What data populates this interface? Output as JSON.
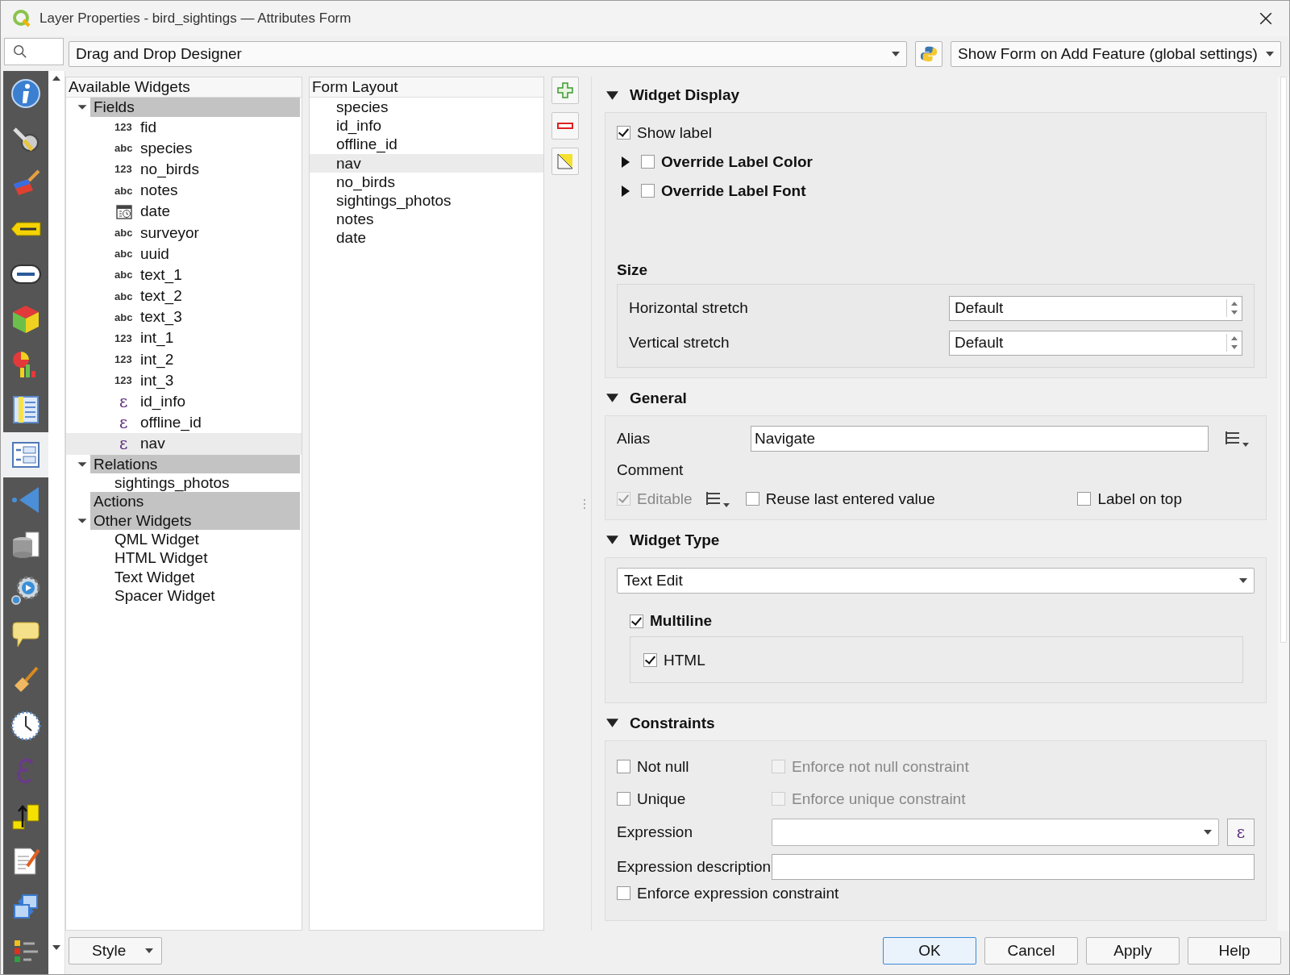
{
  "window": {
    "title": "Layer Properties - bird_sightings — Attributes Form"
  },
  "designer_mode": "Drag and Drop Designer",
  "form_mode": "Show Form on Add Feature (global settings)",
  "sidebar": [
    {
      "kind": "info",
      "selected": false
    },
    {
      "kind": "tools",
      "selected": false
    },
    {
      "kind": "paintbrush",
      "selected": false
    },
    {
      "kind": "label-tag",
      "selected": false
    },
    {
      "kind": "label-bubble",
      "selected": false
    },
    {
      "kind": "cube",
      "selected": false
    },
    {
      "kind": "diagram",
      "selected": false
    },
    {
      "kind": "table",
      "selected": false
    },
    {
      "kind": "form",
      "selected": true
    },
    {
      "kind": "triangle",
      "selected": false
    },
    {
      "kind": "database",
      "selected": false
    },
    {
      "kind": "gear",
      "selected": false
    },
    {
      "kind": "speech",
      "selected": false
    },
    {
      "kind": "brush",
      "selected": false
    },
    {
      "kind": "clock",
      "selected": false
    },
    {
      "kind": "epsilon",
      "selected": false
    },
    {
      "kind": "elevation",
      "selected": false
    },
    {
      "kind": "document",
      "selected": false
    },
    {
      "kind": "sync",
      "selected": false
    },
    {
      "kind": "legend",
      "selected": false
    }
  ],
  "available_widgets": {
    "title": "Available Widgets",
    "groups": [
      {
        "label": "Fields",
        "expanded": true,
        "items": [
          {
            "kind": "badge",
            "badge": "123",
            "label": "fid",
            "selected": false
          },
          {
            "kind": "badge",
            "badge": "abc",
            "label": "species",
            "selected": false
          },
          {
            "kind": "badge",
            "badge": "123",
            "label": "no_birds",
            "selected": false
          },
          {
            "kind": "badge",
            "badge": "abc",
            "label": "notes",
            "selected": false
          },
          {
            "kind": "calendar",
            "label": "date",
            "selected": false
          },
          {
            "kind": "badge",
            "badge": "abc",
            "label": "surveyor",
            "selected": false
          },
          {
            "kind": "badge",
            "badge": "abc",
            "label": "uuid",
            "selected": false
          },
          {
            "kind": "badge",
            "badge": "abc",
            "label": "text_1",
            "selected": false
          },
          {
            "kind": "badge",
            "badge": "abc",
            "label": "text_2",
            "selected": false
          },
          {
            "kind": "badge",
            "badge": "abc",
            "label": "text_3",
            "selected": false
          },
          {
            "kind": "badge",
            "badge": "123",
            "label": "int_1",
            "selected": false
          },
          {
            "kind": "badge",
            "badge": "123",
            "label": "int_2",
            "selected": false
          },
          {
            "kind": "badge",
            "badge": "123",
            "label": "int_3",
            "selected": false
          },
          {
            "kind": "expression",
            "badge": "ε",
            "label": "id_info",
            "selected": false
          },
          {
            "kind": "expression",
            "badge": "ε",
            "label": "offline_id",
            "selected": false
          },
          {
            "kind": "expression",
            "badge": "ε",
            "label": "nav",
            "selected": true
          }
        ]
      },
      {
        "label": "Relations",
        "expanded": true,
        "items": [
          {
            "kind": "plain",
            "label": "sightings_photos",
            "selected": false
          }
        ]
      },
      {
        "label": "Actions"
      },
      {
        "label": "Other Widgets",
        "expanded": true,
        "items": [
          {
            "kind": "plain",
            "label": "QML Widget",
            "selected": false
          },
          {
            "kind": "plain",
            "label": "HTML Widget",
            "selected": false
          },
          {
            "kind": "plain",
            "label": "Text Widget",
            "selected": false
          },
          {
            "kind": "plain",
            "label": "Spacer Widget",
            "selected": false
          }
        ]
      }
    ]
  },
  "form_layout": {
    "title": "Form Layout",
    "items": [
      {
        "label": "species",
        "selected": false
      },
      {
        "label": "id_info",
        "selected": false
      },
      {
        "label": "offline_id",
        "selected": false
      },
      {
        "label": "nav",
        "selected": true
      },
      {
        "label": "no_birds",
        "selected": false
      },
      {
        "label": "sightings_photos",
        "selected": false
      },
      {
        "label": "notes",
        "selected": false
      },
      {
        "label": "date",
        "selected": false
      }
    ]
  },
  "layout_tools": [
    {
      "kind": "add"
    },
    {
      "kind": "remove"
    },
    {
      "kind": "edit"
    }
  ],
  "widget_display": {
    "title": "Widget Display",
    "expanded": true,
    "show_label": {
      "label": "Show label",
      "checked": true
    },
    "overrides": [
      {
        "label": "Override Label Color",
        "checked": false,
        "expanded": false
      },
      {
        "label": "Override Label Font",
        "checked": false,
        "expanded": false
      }
    ],
    "size": {
      "title": "Size",
      "rows": [
        {
          "label": "Horizontal stretch",
          "value": "Default"
        },
        {
          "label": "Vertical stretch",
          "value": "Default"
        }
      ]
    }
  },
  "general": {
    "title": "General",
    "expanded": true,
    "alias": {
      "label": "Alias",
      "value": "Navigate"
    },
    "comment": {
      "label": "Comment"
    },
    "options": [
      {
        "kind": "with-button",
        "label": "Editable",
        "checked": true,
        "disabled": true
      },
      {
        "kind": "plain",
        "label": "Reuse last entered value",
        "checked": false,
        "disabled": false
      },
      {
        "kind": "right",
        "label": "Label on top",
        "checked": false,
        "disabled": false
      }
    ]
  },
  "widget_type": {
    "title": "Widget Type",
    "expanded": true,
    "value": "Text Edit",
    "multiline": {
      "label": "Multiline",
      "checked": true
    },
    "html": {
      "label": "HTML",
      "checked": true
    }
  },
  "constraints": {
    "title": "Constraints",
    "expanded": true,
    "checks": [
      {
        "label": "Not null",
        "checked": false,
        "enforce": {
          "label": "Enforce not null constraint",
          "checked": false,
          "disabled": true
        }
      },
      {
        "label": "Unique",
        "checked": false,
        "enforce": {
          "label": "Enforce unique constraint",
          "checked": false,
          "disabled": true
        }
      }
    ],
    "expression": {
      "label": "Expression",
      "button": "ε"
    },
    "description": {
      "label": "Expression description"
    },
    "enforce_expression": {
      "label": "Enforce expression constraint",
      "checked": false
    }
  },
  "style_button": "Style",
  "buttons": [
    {
      "label": "OK",
      "default": true
    },
    {
      "label": "Cancel",
      "default": false
    },
    {
      "label": "Apply",
      "default": false
    },
    {
      "label": "Help",
      "default": false
    }
  ]
}
